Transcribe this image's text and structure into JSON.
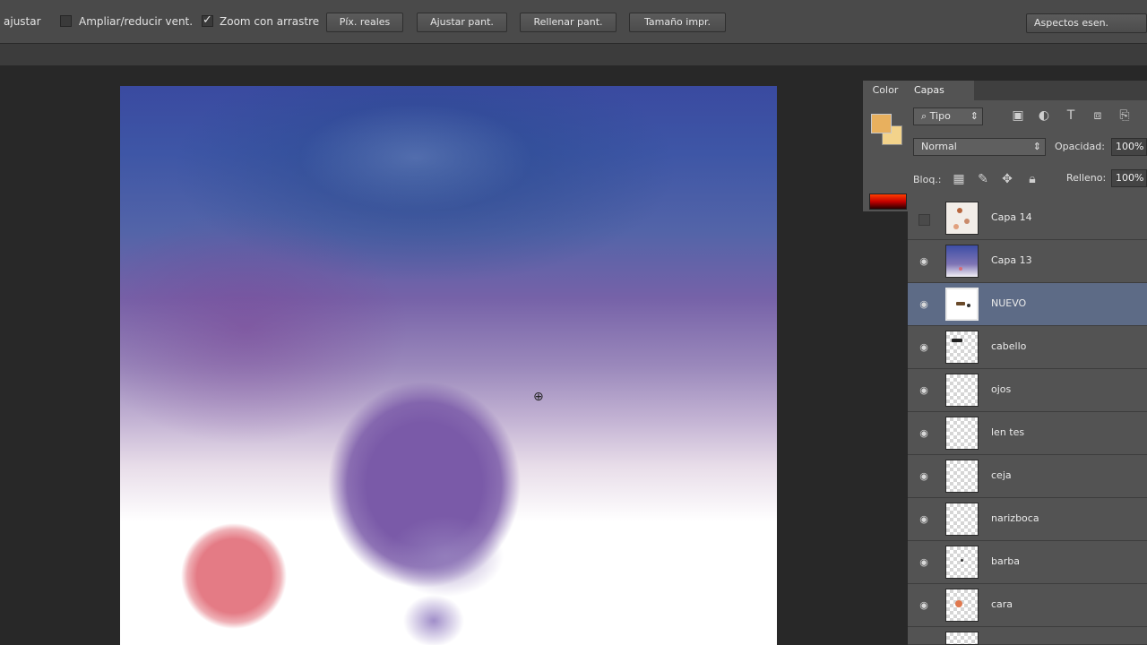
{
  "options_bar": {
    "ajustar_label": "ajustar",
    "resize_windows_label": "Ampliar/reducir vent.",
    "resize_windows_checked": false,
    "scrubby_zoom_label": "Zoom con arrastre",
    "scrubby_zoom_checked": true,
    "buttons": [
      "Píx. reales",
      "Ajustar pant.",
      "Rellenar pant.",
      "Tamaño impr."
    ],
    "workspace": "Aspectos esen."
  },
  "color_panel": {
    "tab": "Color",
    "foreground": "#e8b05e",
    "background": "#f3d38b"
  },
  "layers_panel": {
    "tab": "Capas",
    "filter_kind": "Tipo",
    "blend_mode": "Normal",
    "opacity_label": "Opacidad:",
    "opacity_value": "100%",
    "lock_label": "Bloq.:",
    "fill_label": "Relleno:",
    "fill_value": "100%",
    "filter_icons": [
      "image-filter-icon",
      "adjustment-filter-icon",
      "type-filter-icon",
      "shape-filter-icon",
      "smart-object-filter-icon"
    ],
    "lock_icons": [
      "lock-pixels-icon",
      "lock-brush-icon",
      "lock-position-icon",
      "lock-all-icon"
    ],
    "layers": [
      {
        "name": "Capa 14",
        "visible": false,
        "selected": false,
        "thumb": "sketch"
      },
      {
        "name": "Capa 13",
        "visible": true,
        "selected": false,
        "thumb": "sky"
      },
      {
        "name": "NUEVO",
        "visible": true,
        "selected": true,
        "thumb": "white"
      },
      {
        "name": "cabello",
        "visible": true,
        "selected": false,
        "thumb": "transparent"
      },
      {
        "name": "ojos",
        "visible": true,
        "selected": false,
        "thumb": "transparent"
      },
      {
        "name": "len tes",
        "visible": true,
        "selected": false,
        "thumb": "transparent"
      },
      {
        "name": "ceja",
        "visible": true,
        "selected": false,
        "thumb": "transparent"
      },
      {
        "name": "narizboca",
        "visible": true,
        "selected": false,
        "thumb": "transparent"
      },
      {
        "name": "barba",
        "visible": true,
        "selected": false,
        "thumb": "transparent"
      },
      {
        "name": "cara",
        "visible": true,
        "selected": false,
        "thumb": "transparent"
      }
    ]
  },
  "colors": {
    "panel_bg": "#535353",
    "selected_row": "#5d6b86",
    "canvas_purple": "#7a5aa8",
    "canvas_pink": "#e47b85"
  }
}
